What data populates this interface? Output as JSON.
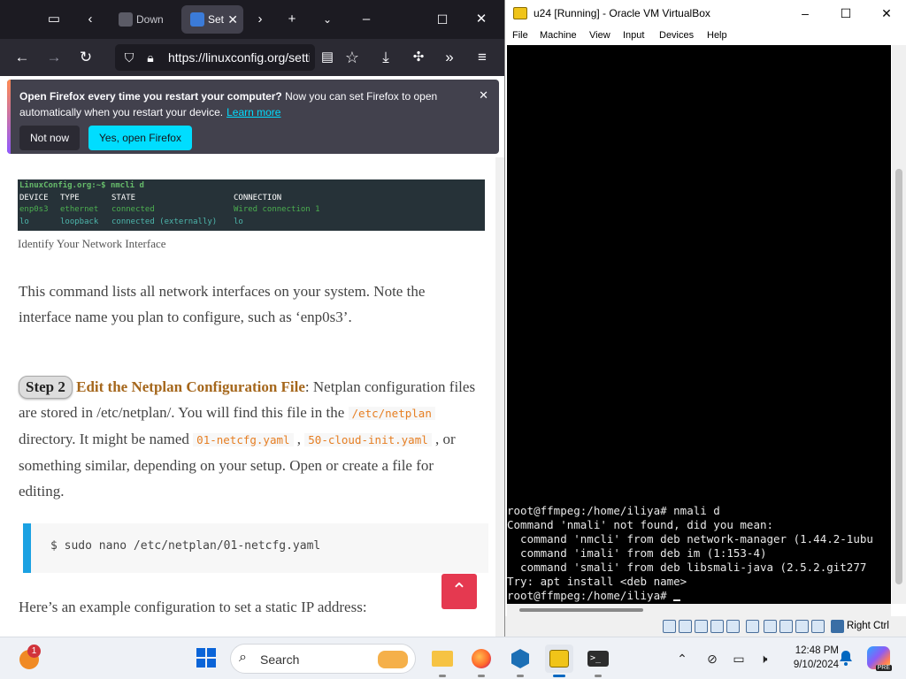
{
  "firefox": {
    "tabs": [
      {
        "label": "Down",
        "active": false
      },
      {
        "label": "Set",
        "active": true
      }
    ],
    "url": "https://linuxconfig.org/setting-a-static-ip",
    "notice": {
      "bold": "Open Firefox every time you restart your computer?",
      "text": " Now you can set Firefox to open automatically when you restart your device.",
      "learn_more": "Learn more",
      "not_now": "Not now",
      "yes": "Yes, open Firefox"
    },
    "article": {
      "terminal_image": {
        "prompt": "LinuxConfig.org:~$ nmcli d",
        "header": [
          "DEVICE",
          "TYPE",
          "STATE",
          "CONNECTION"
        ],
        "rows": [
          [
            "enp0s3",
            "ethernet",
            "connected",
            "Wired connection 1"
          ],
          [
            "lo",
            "loopback",
            "connected (externally)",
            "lo"
          ]
        ]
      },
      "caption": "Identify Your Network Interface",
      "para1": "This command lists all network interfaces on your system. Note the interface name you plan to configure, such as ‘enp0s3’.",
      "step_badge": "Step 2",
      "step_title": "Edit the Netplan Configuration File",
      "step_text_a": ": Netplan configuration files are stored in /etc/netplan/. You will find this file in the ",
      "code_dir": "/etc/netplan",
      "step_text_b": " directory. It might be named ",
      "code_file1": "01-netcfg.yaml",
      "step_text_c": " , ",
      "code_file2": "50-cloud-init.yaml",
      "step_text_d": " , or something similar, depending on your setup. Open or create a file for editing.",
      "code_block": "$ sudo nano /etc/netplan/01-netcfg.yaml",
      "para3": "Here’s an example configuration to set a static IP address:"
    }
  },
  "virtualbox": {
    "title": "u24 [Running] - Oracle VM VirtualBox",
    "menu": [
      "File",
      "Machine",
      "View",
      "Input",
      "Devices",
      "Help"
    ],
    "terminal_lines": [
      "root@ffmpeg:/home/iliya# nmali d",
      "Command 'nmali' not found, did you mean:",
      "  command 'nmcli' from deb network-manager (1.44.2-1ubu",
      "  command 'imali' from deb im (1:153-4)",
      "  command 'smali' from deb libsmali-java (2.5.2.git277",
      "Try: apt install <deb name>",
      "root@ffmpeg:/home/iliya# "
    ],
    "host_key": "Right Ctrl"
  },
  "taskbar": {
    "search_label": "Search",
    "notification_count": "1",
    "time": "12:48 PM",
    "date": "9/10/2024",
    "copilot_badge": "PRE"
  }
}
